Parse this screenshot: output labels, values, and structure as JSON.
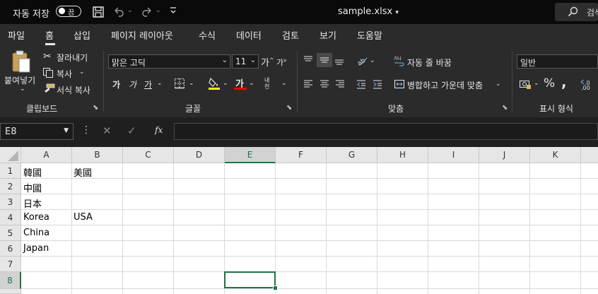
{
  "titlebar": {
    "autosave_label": "자동 저장",
    "autosave_state": "끔",
    "doc_title": "sample.xlsx",
    "search_label": "검색"
  },
  "tabs": [
    "파일",
    "홈",
    "삽입",
    "페이지 레이아웃",
    "수식",
    "데이터",
    "검토",
    "보기",
    "도움말"
  ],
  "active_tab": "홈",
  "ribbon": {
    "clipboard": {
      "paste": "붙여넣기",
      "cut": "잘라내기",
      "copy": "복사",
      "format_painter": "서식 복사",
      "group_label": "클립보드"
    },
    "font": {
      "font_name": "맑은 고딕",
      "font_size": "11",
      "grow": "가",
      "shrink": "가",
      "bold": "가",
      "italic": "가",
      "underline": "가",
      "font_color_glyph": "가",
      "phonetic": "내천",
      "group_label": "글꼴"
    },
    "alignment": {
      "wrap_text": "자동 줄 바꿈",
      "merge_center": "병합하고 가운데 맞춤",
      "group_label": "맞춤"
    },
    "number": {
      "format": "일반",
      "percent": "%",
      "group_label": "표시 형식"
    }
  },
  "formula_bar": {
    "name_box": "E8",
    "fx": "fx",
    "value": ""
  },
  "sheet": {
    "columns": [
      "A",
      "B",
      "C",
      "D",
      "E",
      "F",
      "G",
      "H",
      "I",
      "J",
      "K"
    ],
    "selected_column": "E",
    "rows": [
      "1",
      "2",
      "3",
      "4",
      "5",
      "6",
      "7",
      "8"
    ],
    "selected_row": "8",
    "cells": {
      "A1": "韓國",
      "B1": "美國",
      "A2": "中國",
      "A3": "日本",
      "A4": "Korea",
      "B4": "USA",
      "A5": "China",
      "A6": "Japan"
    }
  },
  "colors": {
    "accent": "#217346",
    "titlebar": "#0a0a0a",
    "ribbon": "#2b2b2b",
    "font_color_bar": "#ffff00",
    "highlight_bar": "#ff0000"
  }
}
